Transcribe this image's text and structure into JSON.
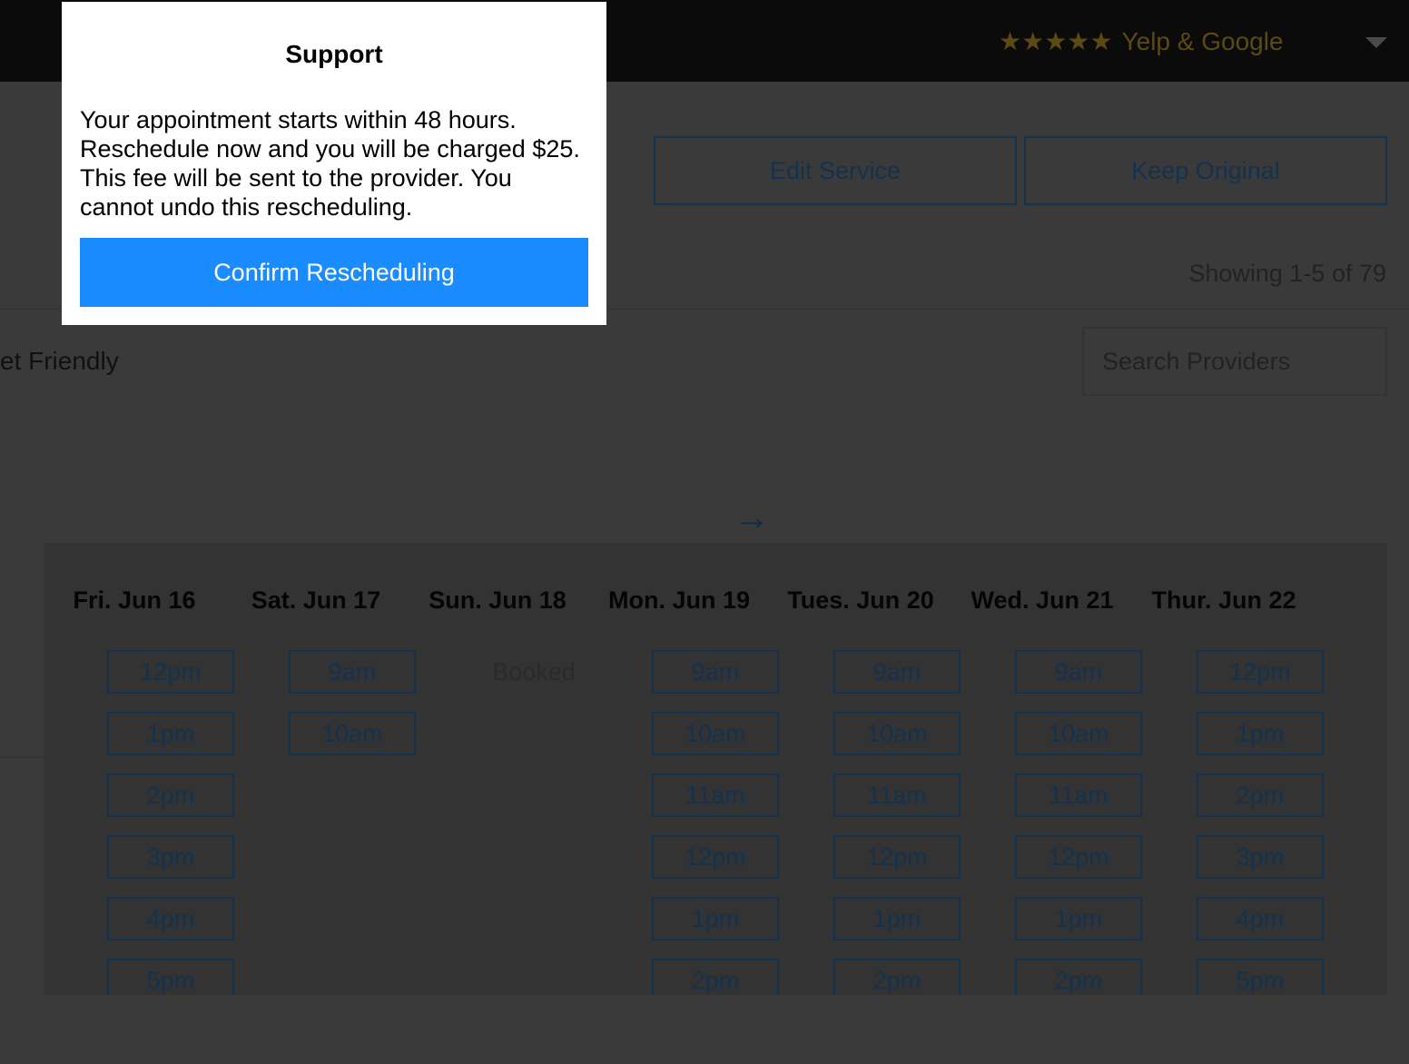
{
  "header": {
    "rating_stars": "★★★★★",
    "rating_text": "Yelp & Google"
  },
  "actions": {
    "edit_service_label": "Edit Service",
    "keep_original_label": "Keep Original"
  },
  "results": {
    "showing_text": "Showing 1-5 of 79"
  },
  "filters": {
    "visible_label": "et Friendly"
  },
  "search": {
    "placeholder": "Search Providers"
  },
  "nav": {
    "next_arrow": "→"
  },
  "calendar": {
    "days": [
      {
        "label": "Fri. Jun 16",
        "slots": [
          "12pm",
          "1pm",
          "2pm",
          "3pm",
          "4pm",
          "5pm"
        ]
      },
      {
        "label": "Sat. Jun 17",
        "slots": [
          "9am",
          "10am"
        ]
      },
      {
        "label": "Sun. Jun 18",
        "booked": "Booked",
        "slots": []
      },
      {
        "label": "Mon. Jun 19",
        "slots": [
          "9am",
          "10am",
          "11am",
          "12pm",
          "1pm",
          "2pm"
        ]
      },
      {
        "label": "Tues. Jun 20",
        "slots": [
          "9am",
          "10am",
          "11am",
          "12pm",
          "1pm",
          "2pm"
        ]
      },
      {
        "label": "Wed. Jun 21",
        "slots": [
          "9am",
          "10am",
          "11am",
          "12pm",
          "1pm",
          "2pm"
        ]
      },
      {
        "label": "Thur. Jun 22",
        "slots": [
          "12pm",
          "1pm",
          "2pm",
          "3pm",
          "4pm",
          "5pm"
        ]
      }
    ]
  },
  "modal": {
    "title": "Support",
    "body": "Your appointment starts within 48 hours. Reschedule now and you will be charged $25. This fee will be sent to the provider. You cannot undo this rescheduling.",
    "confirm_label": "Confirm Rescheduling"
  },
  "colors": {
    "accent": "#1a8cff",
    "overlay_bg": "#3a3a3a",
    "topbar_bg": "#0b0b0b",
    "star": "#5b4a12"
  }
}
